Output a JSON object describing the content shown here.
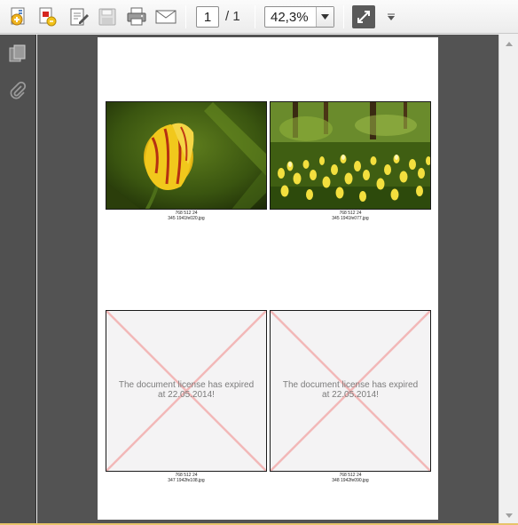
{
  "toolbar": {
    "page_current": "1",
    "page_separator": "/ 1",
    "zoom": "42,3%",
    "icons": [
      "create-icon",
      "convert-icon",
      "sign-icon",
      "save-icon",
      "print-icon",
      "email-icon",
      "fit-page-icon",
      "toolbar-menu-icon"
    ]
  },
  "sidebar": {
    "icons": [
      "page-thumbnails-icon",
      "attachments-icon"
    ]
  },
  "document": {
    "images": [
      {
        "caption_line1": "768 512 24",
        "caption_line2": "345 1941fe020.jpg"
      },
      {
        "caption_line1": "768 512 24",
        "caption_line2": "345 1941fe077.jpg"
      },
      {
        "caption_line1": "768 512 24",
        "caption_line2": "347 1942fe108.jpg",
        "overlay": "The document license has expired at 22.05.2014!"
      },
      {
        "caption_line1": "768 512 24",
        "caption_line2": "348 1942fe090.jpg",
        "overlay": "The document license has expired at 22.05.2014!"
      }
    ]
  },
  "colors": {
    "toolbar_bg": "#ececec",
    "doc_bg": "#535353",
    "sidebar_bg": "#505050",
    "expired_cross": "#f2b8b8"
  }
}
